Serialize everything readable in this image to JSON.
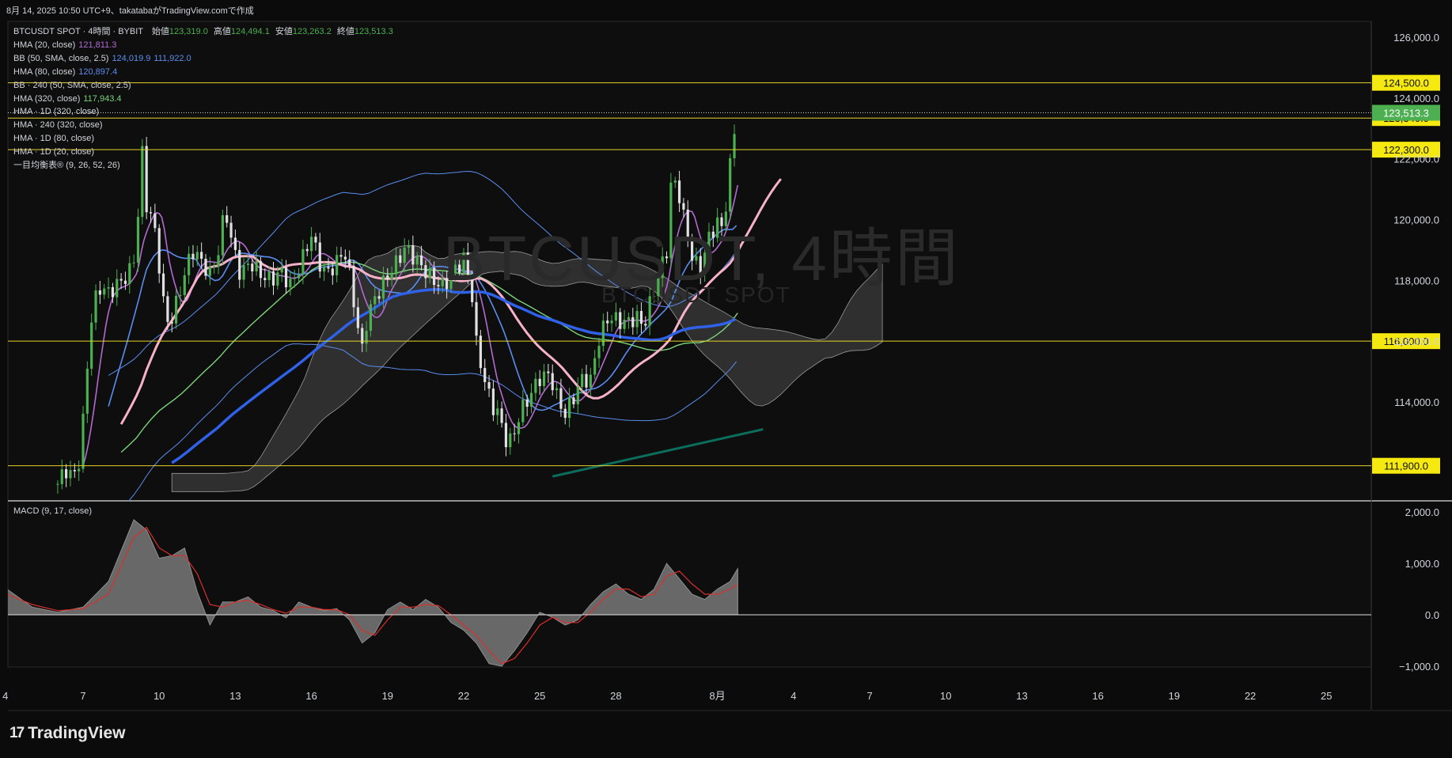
{
  "header": {
    "text": "8月 14, 2025 10:50 UTC+9、takatabaがTradingView.comで作成"
  },
  "symbol_line": {
    "title": "BTCUSDT SPOT · 4時間 · BYBIT",
    "open_label": "始値",
    "open": "123,319.0",
    "high_label": "高値",
    "high": "124,494.1",
    "low_label": "安値",
    "low": "123,263.2",
    "close_label": "終値",
    "close": "123,513.3"
  },
  "legend": [
    {
      "label": "HMA (20, close)",
      "values": [
        "121,811.3"
      ],
      "color": "#b36ad0"
    },
    {
      "label": "BB (50, SMA, close, 2.5)",
      "values": [
        "124,019.9",
        "111,922.0"
      ],
      "color": "#5b8dee"
    },
    {
      "label": "HMA (80, close)",
      "values": [
        "120,897.4"
      ],
      "color": "#5b8dee"
    },
    {
      "label": "BB · 240 (50, SMA, close, 2.5)",
      "values": [],
      "color": ""
    },
    {
      "label": "HMA (320, close)",
      "values": [
        "117,943.4"
      ],
      "color": "#7bd47b"
    },
    {
      "label": "HMA · 1D (320, close)",
      "values": [],
      "color": ""
    },
    {
      "label": "HMA · 240 (320, close)",
      "values": [],
      "color": ""
    },
    {
      "label": "HMA · 1D (80, close)",
      "values": [],
      "color": ""
    },
    {
      "label": "HMA · 1D (20, close)",
      "values": [],
      "color": ""
    },
    {
      "label": "一目均衡表® (9, 26, 52, 26)",
      "values": [],
      "color": ""
    }
  ],
  "watermark": {
    "main": "BTCUSDT, 4時間",
    "sub": "BTCUSDT SPOT"
  },
  "macd_label": "MACD (9, 17, close)",
  "brand": {
    "logo": "17",
    "name": "TradingView"
  },
  "colors": {
    "background": "#0b0b0b",
    "candle_up": "#4caf50",
    "candle_down": "#e0e0e0",
    "hline": "#e6d22a",
    "price_tag": "#f5e90f",
    "last_price_tag": "#4caf50",
    "bb": "#5b8dee",
    "hma20": "#b36ad0",
    "hma80": "#5b8dee",
    "hma320": "#7bd47b",
    "hma_pink": "#f7b2c8",
    "hma_blue_bold": "#2f62e8",
    "teal_line": "#0b6e5c",
    "cloud": "#4a4a4a",
    "macd_area": "#787878",
    "signal": "#d9302c"
  },
  "chart_data": [
    {
      "type": "line",
      "title": "BTCUSDT SPOT · 4時間 · BYBIT",
      "y_axis_ticks": [
        "126,000.0",
        "124,000.0",
        "122,000.0",
        "120,000.0",
        "118,000.0",
        "116,000.0",
        "114,000.0"
      ],
      "ylim": [
        110800,
        126600
      ],
      "x_tick_labels": [
        "4",
        "7",
        "10",
        "13",
        "16",
        "19",
        "22",
        "25",
        "28",
        "8月",
        "4",
        "7",
        "10",
        "13",
        "16",
        "19",
        "22",
        "25"
      ],
      "horizontal_levels": [
        {
          "value": 124500,
          "label": "124,500.0"
        },
        {
          "value": 123340,
          "label": "123,340.0"
        },
        {
          "value": 122300,
          "label": "122,300.0"
        },
        {
          "value": 116000,
          "label": "116,000.0"
        },
        {
          "value": 111900,
          "label": "111,900.0"
        }
      ],
      "last_price": {
        "value": 123513.3,
        "label": "123,513.3"
      },
      "price_path": [
        {
          "d": 6.0,
          "v": 111300
        },
        {
          "d": 6.3,
          "v": 111800
        },
        {
          "d": 6.6,
          "v": 111500
        },
        {
          "d": 6.9,
          "v": 112200
        },
        {
          "d": 7.1,
          "v": 114500
        },
        {
          "d": 7.3,
          "v": 116600
        },
        {
          "d": 7.6,
          "v": 117800
        },
        {
          "d": 8.0,
          "v": 117600
        },
        {
          "d": 8.4,
          "v": 117900
        },
        {
          "d": 8.8,
          "v": 118200
        },
        {
          "d": 9.1,
          "v": 119000
        },
        {
          "d": 9.3,
          "v": 122500
        },
        {
          "d": 9.5,
          "v": 120500
        },
        {
          "d": 9.8,
          "v": 119800
        },
        {
          "d": 10.0,
          "v": 118500
        },
        {
          "d": 10.2,
          "v": 117000
        },
        {
          "d": 10.4,
          "v": 116500
        },
        {
          "d": 10.7,
          "v": 117300
        },
        {
          "d": 11.0,
          "v": 118200
        },
        {
          "d": 11.3,
          "v": 119000
        },
        {
          "d": 11.6,
          "v": 118700
        },
        {
          "d": 12.0,
          "v": 118200
        },
        {
          "d": 12.3,
          "v": 118800
        },
        {
          "d": 12.6,
          "v": 120400
        },
        {
          "d": 12.9,
          "v": 119100
        },
        {
          "d": 13.2,
          "v": 118200
        },
        {
          "d": 13.6,
          "v": 118600
        },
        {
          "d": 14.0,
          "v": 118200
        },
        {
          "d": 14.4,
          "v": 118000
        },
        {
          "d": 14.8,
          "v": 118300
        },
        {
          "d": 15.2,
          "v": 117800
        },
        {
          "d": 15.6,
          "v": 118600
        },
        {
          "d": 16.0,
          "v": 119500
        },
        {
          "d": 16.3,
          "v": 118600
        },
        {
          "d": 16.6,
          "v": 118200
        },
        {
          "d": 17.0,
          "v": 118600
        },
        {
          "d": 17.3,
          "v": 119000
        },
        {
          "d": 17.5,
          "v": 118200
        },
        {
          "d": 17.8,
          "v": 116600
        },
        {
          "d": 18.0,
          "v": 115700
        },
        {
          "d": 18.2,
          "v": 116800
        },
        {
          "d": 18.5,
          "v": 117400
        },
        {
          "d": 18.9,
          "v": 118000
        },
        {
          "d": 19.3,
          "v": 118500
        },
        {
          "d": 19.7,
          "v": 119100
        },
        {
          "d": 20.0,
          "v": 118800
        },
        {
          "d": 20.4,
          "v": 118400
        },
        {
          "d": 20.8,
          "v": 118000
        },
        {
          "d": 21.2,
          "v": 117800
        },
        {
          "d": 21.6,
          "v": 118300
        },
        {
          "d": 22.0,
          "v": 118700
        },
        {
          "d": 22.3,
          "v": 117800
        },
        {
          "d": 22.5,
          "v": 115900
        },
        {
          "d": 22.8,
          "v": 114800
        },
        {
          "d": 23.1,
          "v": 113900
        },
        {
          "d": 23.4,
          "v": 113600
        },
        {
          "d": 23.6,
          "v": 112800
        },
        {
          "d": 23.9,
          "v": 112700
        },
        {
          "d": 24.2,
          "v": 113600
        },
        {
          "d": 24.6,
          "v": 114200
        },
        {
          "d": 25.0,
          "v": 114800
        },
        {
          "d": 25.4,
          "v": 114900
        },
        {
          "d": 25.7,
          "v": 114100
        },
        {
          "d": 26.0,
          "v": 113600
        },
        {
          "d": 26.3,
          "v": 114100
        },
        {
          "d": 26.7,
          "v": 114800
        },
        {
          "d": 27.0,
          "v": 114700
        },
        {
          "d": 27.3,
          "v": 116000
        },
        {
          "d": 27.7,
          "v": 116800
        },
        {
          "d": 28.0,
          "v": 116700
        },
        {
          "d": 28.4,
          "v": 116600
        },
        {
          "d": 28.8,
          "v": 116800
        },
        {
          "d": 29.1,
          "v": 116500
        },
        {
          "d": 29.4,
          "v": 117400
        },
        {
          "d": 29.7,
          "v": 118200
        },
        {
          "d": 30.0,
          "v": 119000
        },
        {
          "d": 30.2,
          "v": 121500
        },
        {
          "d": 30.5,
          "v": 120800
        },
        {
          "d": 30.8,
          "v": 119500
        },
        {
          "d": 31.0,
          "v": 118800
        },
        {
          "d": 31.3,
          "v": 118300
        },
        {
          "d": 31.7,
          "v": 119500
        },
        {
          "d": 32.0,
          "v": 119900
        },
        {
          "d": 32.2,
          "v": 119700
        },
        {
          "d": 32.4,
          "v": 120900
        },
        {
          "d": 32.6,
          "v": 122600
        },
        {
          "d": 32.7,
          "v": 123100
        },
        {
          "d": 32.8,
          "v": 123500
        }
      ]
    },
    {
      "type": "area",
      "title": "MACD (9, 17, close)",
      "y_axis_ticks": [
        "2,000.0",
        "1,000.0",
        "0.0",
        "−1,000.0"
      ],
      "ylim": [
        -1350,
        2200
      ],
      "macd": [
        {
          "d": 4.0,
          "v": 500
        },
        {
          "d": 5.0,
          "v": 150
        },
        {
          "d": 6.0,
          "v": 50
        },
        {
          "d": 7.0,
          "v": 150
        },
        {
          "d": 8.0,
          "v": 650
        },
        {
          "d": 9.0,
          "v": 1850
        },
        {
          "d": 9.5,
          "v": 1650
        },
        {
          "d": 10.0,
          "v": 1100
        },
        {
          "d": 10.5,
          "v": 1150
        },
        {
          "d": 11.0,
          "v": 1300
        },
        {
          "d": 11.5,
          "v": 450
        },
        {
          "d": 12.0,
          "v": -200
        },
        {
          "d": 12.5,
          "v": 250
        },
        {
          "d": 13.0,
          "v": 250
        },
        {
          "d": 13.5,
          "v": 350
        },
        {
          "d": 14.0,
          "v": 150
        },
        {
          "d": 14.5,
          "v": 80
        },
        {
          "d": 15.0,
          "v": -60
        },
        {
          "d": 15.5,
          "v": 250
        },
        {
          "d": 16.0,
          "v": 150
        },
        {
          "d": 16.5,
          "v": 80
        },
        {
          "d": 17.0,
          "v": 120
        },
        {
          "d": 17.5,
          "v": -100
        },
        {
          "d": 18.0,
          "v": -550
        },
        {
          "d": 18.5,
          "v": -350
        },
        {
          "d": 19.0,
          "v": 100
        },
        {
          "d": 19.5,
          "v": 250
        },
        {
          "d": 20.0,
          "v": 100
        },
        {
          "d": 20.5,
          "v": 300
        },
        {
          "d": 21.0,
          "v": 150
        },
        {
          "d": 21.5,
          "v": -150
        },
        {
          "d": 22.0,
          "v": -300
        },
        {
          "d": 22.5,
          "v": -550
        },
        {
          "d": 23.0,
          "v": -950
        },
        {
          "d": 23.5,
          "v": -1000
        },
        {
          "d": 24.0,
          "v": -700
        },
        {
          "d": 24.5,
          "v": -350
        },
        {
          "d": 25.0,
          "v": 50
        },
        {
          "d": 25.5,
          "v": -50
        },
        {
          "d": 26.0,
          "v": -200
        },
        {
          "d": 26.5,
          "v": -100
        },
        {
          "d": 27.0,
          "v": 200
        },
        {
          "d": 27.5,
          "v": 450
        },
        {
          "d": 28.0,
          "v": 600
        },
        {
          "d": 28.5,
          "v": 400
        },
        {
          "d": 29.0,
          "v": 300
        },
        {
          "d": 29.5,
          "v": 500
        },
        {
          "d": 30.0,
          "v": 1000
        },
        {
          "d": 30.5,
          "v": 700
        },
        {
          "d": 31.0,
          "v": 400
        },
        {
          "d": 31.5,
          "v": 300
        },
        {
          "d": 32.0,
          "v": 500
        },
        {
          "d": 32.5,
          "v": 650
        },
        {
          "d": 32.8,
          "v": 900
        }
      ],
      "signal": [
        {
          "d": 4.0,
          "v": 400
        },
        {
          "d": 5.0,
          "v": 200
        },
        {
          "d": 6.0,
          "v": 80
        },
        {
          "d": 7.0,
          "v": 120
        },
        {
          "d": 8.0,
          "v": 400
        },
        {
          "d": 9.0,
          "v": 1500
        },
        {
          "d": 9.5,
          "v": 1700
        },
        {
          "d": 10.0,
          "v": 1300
        },
        {
          "d": 10.5,
          "v": 1150
        },
        {
          "d": 11.0,
          "v": 1150
        },
        {
          "d": 11.5,
          "v": 800
        },
        {
          "d": 12.0,
          "v": 200
        },
        {
          "d": 12.5,
          "v": 150
        },
        {
          "d": 13.0,
          "v": 250
        },
        {
          "d": 13.5,
          "v": 280
        },
        {
          "d": 14.0,
          "v": 200
        },
        {
          "d": 14.5,
          "v": 100
        },
        {
          "d": 15.0,
          "v": 30
        },
        {
          "d": 15.5,
          "v": 150
        },
        {
          "d": 16.0,
          "v": 150
        },
        {
          "d": 16.5,
          "v": 100
        },
        {
          "d": 17.0,
          "v": 100
        },
        {
          "d": 17.5,
          "v": 0
        },
        {
          "d": 18.0,
          "v": -300
        },
        {
          "d": 18.5,
          "v": -400
        },
        {
          "d": 19.0,
          "v": -100
        },
        {
          "d": 19.5,
          "v": 150
        },
        {
          "d": 20.0,
          "v": 150
        },
        {
          "d": 20.5,
          "v": 200
        },
        {
          "d": 21.0,
          "v": 180
        },
        {
          "d": 21.5,
          "v": 0
        },
        {
          "d": 22.0,
          "v": -200
        },
        {
          "d": 22.5,
          "v": -400
        },
        {
          "d": 23.0,
          "v": -700
        },
        {
          "d": 23.5,
          "v": -950
        },
        {
          "d": 24.0,
          "v": -850
        },
        {
          "d": 24.5,
          "v": -550
        },
        {
          "d": 25.0,
          "v": -200
        },
        {
          "d": 25.5,
          "v": -50
        },
        {
          "d": 26.0,
          "v": -150
        },
        {
          "d": 26.5,
          "v": -150
        },
        {
          "d": 27.0,
          "v": 50
        },
        {
          "d": 27.5,
          "v": 300
        },
        {
          "d": 28.0,
          "v": 500
        },
        {
          "d": 28.5,
          "v": 500
        },
        {
          "d": 29.0,
          "v": 350
        },
        {
          "d": 29.5,
          "v": 400
        },
        {
          "d": 30.0,
          "v": 750
        },
        {
          "d": 30.5,
          "v": 850
        },
        {
          "d": 31.0,
          "v": 600
        },
        {
          "d": 31.5,
          "v": 400
        },
        {
          "d": 32.0,
          "v": 400
        },
        {
          "d": 32.5,
          "v": 500
        },
        {
          "d": 32.8,
          "v": 600
        }
      ]
    }
  ]
}
